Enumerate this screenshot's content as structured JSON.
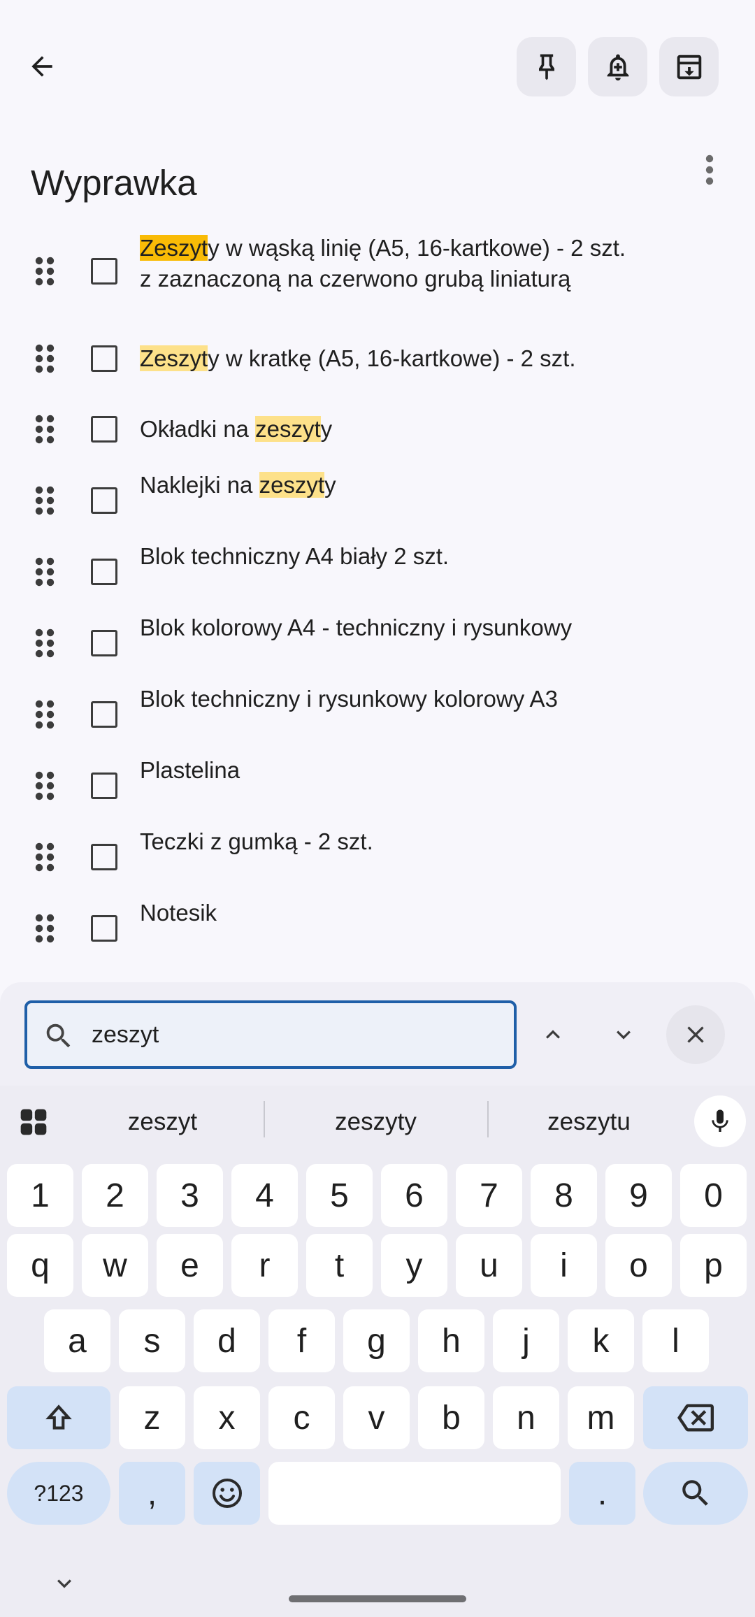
{
  "toolbar": {
    "back_icon": "arrow-left-icon",
    "pin_icon": "pin-icon",
    "reminder_icon": "bell-plus-icon",
    "archive_icon": "archive-icon",
    "more_icon": "more-vert-icon"
  },
  "note": {
    "title": "Wyprawka",
    "items": [
      {
        "segments": [
          {
            "text": "Zeszyt",
            "hl": "strong"
          },
          {
            "text": "y w wąską linię (A5, 16-kartkowe) - 2 szt.\nz zaznaczoną na czerwono grubą liniaturą",
            "hl": ""
          }
        ],
        "checked": false
      },
      {
        "segments": [
          {
            "text": "Zeszyt",
            "hl": "light"
          },
          {
            "text": "y w kratkę (A5, 16-kartkowe) - 2 szt.",
            "hl": ""
          }
        ],
        "checked": false
      },
      {
        "segments": [
          {
            "text": "Okładki na ",
            "hl": ""
          },
          {
            "text": "zeszyt",
            "hl": "light"
          },
          {
            "text": "y",
            "hl": ""
          }
        ],
        "checked": false
      },
      {
        "segments": [
          {
            "text": "Naklejki na ",
            "hl": ""
          },
          {
            "text": "zeszyt",
            "hl": "light"
          },
          {
            "text": "y",
            "hl": ""
          }
        ],
        "checked": false
      },
      {
        "segments": [
          {
            "text": "Blok techniczny A4 biały 2 szt.",
            "hl": ""
          }
        ],
        "checked": false
      },
      {
        "segments": [
          {
            "text": "Blok kolorowy A4 - techniczny i rysunkowy",
            "hl": ""
          }
        ],
        "checked": false
      },
      {
        "segments": [
          {
            "text": "Blok techniczny i rysunkowy kolorowy A3",
            "hl": ""
          }
        ],
        "checked": false
      },
      {
        "segments": [
          {
            "text": "Plastelina",
            "hl": ""
          }
        ],
        "checked": false
      },
      {
        "segments": [
          {
            "text": "Teczki z gumką - 2 szt.",
            "hl": ""
          }
        ],
        "checked": false
      },
      {
        "segments": [
          {
            "text": "Notesik",
            "hl": ""
          }
        ],
        "checked": false
      }
    ]
  },
  "find": {
    "query": "zeszyt",
    "search_icon": "search-icon",
    "prev_icon": "chevron-up-icon",
    "next_icon": "chevron-down-icon",
    "close_icon": "close-icon"
  },
  "keyboard": {
    "suggestions": [
      "zeszyt",
      "zeszyty",
      "zeszytu"
    ],
    "row_numbers": [
      "1",
      "2",
      "3",
      "4",
      "5",
      "6",
      "7",
      "8",
      "9",
      "0"
    ],
    "row1": [
      "q",
      "w",
      "e",
      "r",
      "t",
      "y",
      "u",
      "i",
      "o",
      "p"
    ],
    "row2": [
      "a",
      "s",
      "d",
      "f",
      "g",
      "h",
      "j",
      "k",
      "l"
    ],
    "row3": [
      "z",
      "x",
      "c",
      "v",
      "b",
      "n",
      "m"
    ],
    "symbols_label": "?123",
    "comma": ",",
    "period": ".",
    "colors": {
      "function_key": "#d3e2f7",
      "highlight_strong": "#f9bb06",
      "highlight_light": "#fde18a",
      "accent": "#1f5fa8"
    }
  }
}
